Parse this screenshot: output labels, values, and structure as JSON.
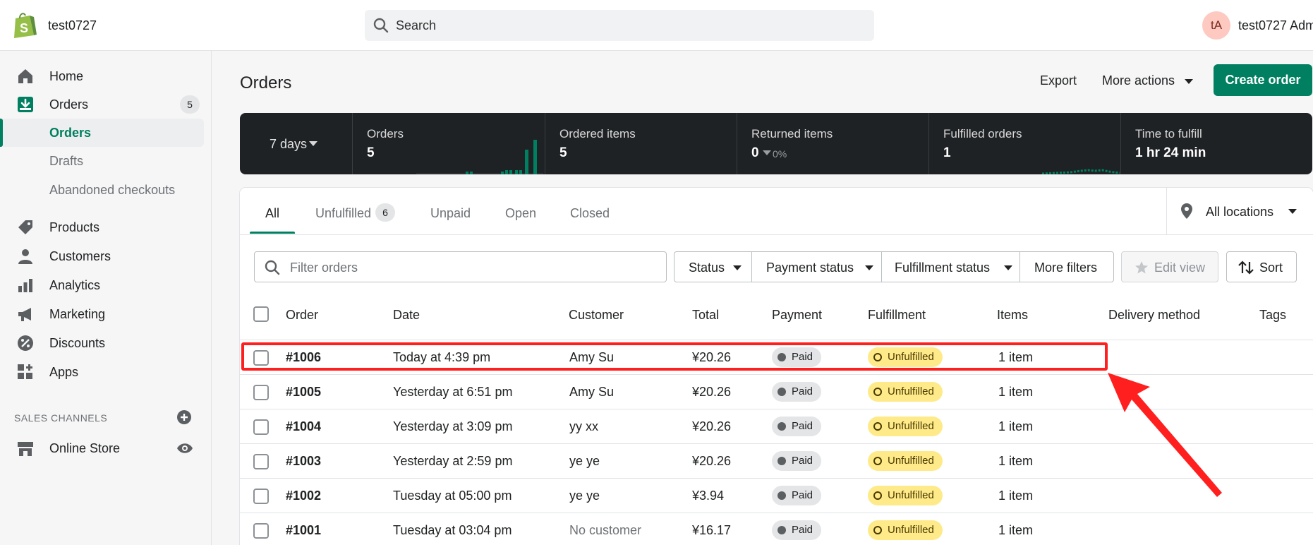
{
  "topbar": {
    "shop_name": "test0727",
    "search_placeholder": "Search",
    "avatar_initials": "tA",
    "user_name": "test0727 Adm"
  },
  "sidebar": {
    "home": "Home",
    "orders": "Orders",
    "orders_badge": "5",
    "sub_orders": "Orders",
    "drafts": "Drafts",
    "abandoned": "Abandoned checkouts",
    "products": "Products",
    "customers": "Customers",
    "analytics": "Analytics",
    "marketing": "Marketing",
    "discounts": "Discounts",
    "apps": "Apps",
    "sales_channels": "SALES CHANNELS",
    "online_store": "Online Store"
  },
  "header": {
    "title": "Orders",
    "export": "Export",
    "more_actions": "More actions",
    "create_order": "Create order"
  },
  "stats": {
    "period": "7 days",
    "orders_label": "Orders",
    "orders_value": "5",
    "ordered_items_label": "Ordered items",
    "ordered_items_value": "5",
    "returned_items_label": "Returned items",
    "returned_items_value": "0",
    "returned_items_pct": "0%",
    "fulfilled_label": "Fulfilled orders",
    "fulfilled_value": "1",
    "time_label": "Time to fulfill",
    "time_value": "1 hr 24 min"
  },
  "tabs": {
    "all": "All",
    "unfulfilled": "Unfulfilled",
    "unfulfilled_count": "6",
    "unpaid": "Unpaid",
    "open": "Open",
    "closed": "Closed",
    "locations": "All locations"
  },
  "filters": {
    "placeholder": "Filter orders",
    "status": "Status",
    "payment_status": "Payment status",
    "fulfillment_status": "Fulfillment status",
    "more_filters": "More filters",
    "edit_view": "Edit view",
    "sort": "Sort"
  },
  "columns": {
    "order": "Order",
    "date": "Date",
    "customer": "Customer",
    "total": "Total",
    "payment": "Payment",
    "fulfillment": "Fulfillment",
    "items": "Items",
    "delivery": "Delivery method",
    "tags": "Tags"
  },
  "orders": [
    {
      "order": "#1006",
      "date": "Today at 4:39 pm",
      "customer": "Amy Su",
      "total": "¥20.26",
      "payment": "Paid",
      "fulfillment": "Unfulfilled",
      "items": "1 item"
    },
    {
      "order": "#1005",
      "date": "Yesterday at 6:51 pm",
      "customer": "Amy Su",
      "total": "¥20.26",
      "payment": "Paid",
      "fulfillment": "Unfulfilled",
      "items": "1 item"
    },
    {
      "order": "#1004",
      "date": "Yesterday at 3:09 pm",
      "customer": "yy xx",
      "total": "¥20.26",
      "payment": "Paid",
      "fulfillment": "Unfulfilled",
      "items": "1 item"
    },
    {
      "order": "#1003",
      "date": "Yesterday at 2:59 pm",
      "customer": "ye ye",
      "total": "¥20.26",
      "payment": "Paid",
      "fulfillment": "Unfulfilled",
      "items": "1 item"
    },
    {
      "order": "#1002",
      "date": "Tuesday at 05:00 pm",
      "customer": "ye ye",
      "total": "¥3.94",
      "payment": "Paid",
      "fulfillment": "Unfulfilled",
      "items": "1 item"
    },
    {
      "order": "#1001",
      "date": "Tuesday at 03:04 pm",
      "customer": "No customer",
      "total": "¥16.17",
      "payment": "Paid",
      "fulfillment": "Unfulfilled",
      "items": "1 item"
    }
  ],
  "colors": {
    "accent": "#008060",
    "stats_bg": "#1f2225",
    "unfulfilled_badge": "#ffea8a",
    "annotation": "#ff1f1f"
  }
}
